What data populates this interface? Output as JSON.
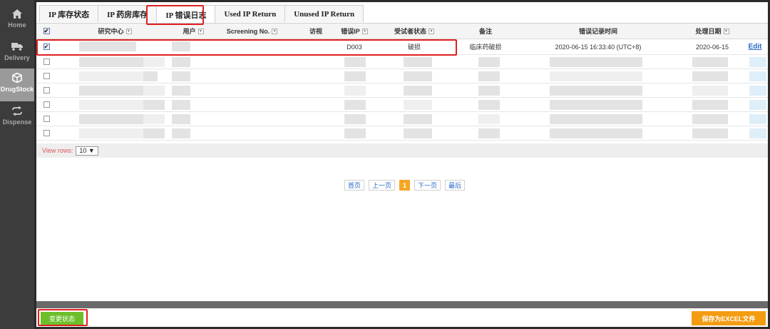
{
  "sidebar": {
    "items": [
      {
        "label": "Home",
        "icon": "home-icon"
      },
      {
        "label": "Delivery",
        "icon": "truck-icon"
      },
      {
        "label": "DrugStock",
        "icon": "box-icon"
      },
      {
        "label": "Dispense",
        "icon": "refresh-icon"
      }
    ],
    "active": "DrugStock"
  },
  "tabs": [
    {
      "label": "IP 库存状态"
    },
    {
      "label": "IP 药房库存"
    },
    {
      "label": "IP 错误日志"
    },
    {
      "label": "Used IP Return"
    },
    {
      "label": "Unused IP Return"
    }
  ],
  "active_tab": "IP 错误日志",
  "table": {
    "columns": [
      "研究中心",
      "用户",
      "Screening No.",
      "访视",
      "错误IP",
      "受试者状态",
      "备注",
      "错误记录时间",
      "处理日期"
    ],
    "first_row": {
      "checked": true,
      "error_ip": "D003",
      "subject_status": "破损",
      "remark": "临床药破损",
      "error_time": "2020-06-15 16:33:40 (UTC+8)",
      "process_date": "2020-06-15",
      "action": "Edit"
    }
  },
  "view_rows": {
    "label": "View rows:",
    "value": "10"
  },
  "pager": {
    "first": "首页",
    "prev": "上一页",
    "current": "1",
    "next": "下一页",
    "last": "最后"
  },
  "buttons": {
    "change_status": "变更状态",
    "export_excel": "保存为EXCEL文件"
  },
  "colors": {
    "accent_green": "#6cbf2a",
    "accent_orange": "#f39c12",
    "highlight_red": "#e02020",
    "link_blue": "#2a67c5"
  }
}
